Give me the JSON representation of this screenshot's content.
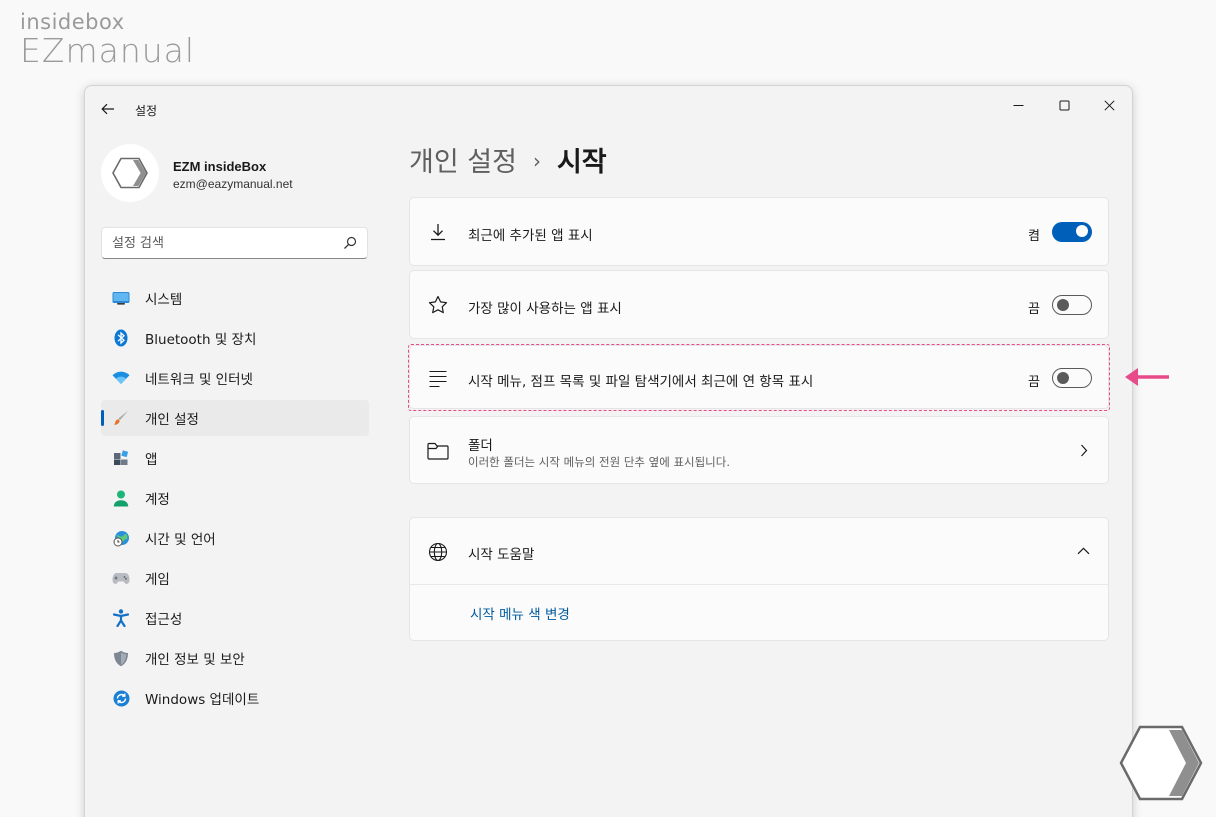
{
  "watermark": {
    "line1": "insidebox",
    "line2": "EZmanual"
  },
  "window": {
    "title": "설정"
  },
  "profile": {
    "name": "EZM insideBox",
    "email": "ezm@eazymanual.net"
  },
  "search": {
    "placeholder": "설정 검색"
  },
  "nav": {
    "items": [
      {
        "label": "시스템",
        "icon": "monitor-icon"
      },
      {
        "label": "Bluetooth 및 장치",
        "icon": "bluetooth-icon"
      },
      {
        "label": "네트워크 및 인터넷",
        "icon": "wifi-icon"
      },
      {
        "label": "개인 설정",
        "icon": "paintbrush-icon"
      },
      {
        "label": "앱",
        "icon": "apps-icon"
      },
      {
        "label": "계정",
        "icon": "person-icon"
      },
      {
        "label": "시간 및 언어",
        "icon": "globe-clock-icon"
      },
      {
        "label": "게임",
        "icon": "gamepad-icon"
      },
      {
        "label": "접근성",
        "icon": "accessibility-icon"
      },
      {
        "label": "개인 정보 및 보안",
        "icon": "shield-icon"
      },
      {
        "label": "Windows 업데이트",
        "icon": "update-icon"
      }
    ],
    "active_index": 3
  },
  "breadcrumb": {
    "parent": "개인 설정",
    "separator": "›",
    "current": "시작"
  },
  "settings": {
    "recent_apps": {
      "label": "최근에 추가된 앱 표시",
      "state": "켬",
      "on": true
    },
    "most_used": {
      "label": "가장 많이 사용하는 앱 표시",
      "state": "끔",
      "on": false
    },
    "recent_items": {
      "label": "시작 메뉴, 점프 목록 및 파일 탐색기에서 최근에 연 항목 표시",
      "state": "끔",
      "on": false
    },
    "folders": {
      "label": "폴더",
      "sub": "이러한 폴더는 시작 메뉴의 전원 단추 옆에 표시됩니다."
    }
  },
  "help": {
    "title": "시작 도움말",
    "link": "시작 메뉴 색 변경"
  },
  "colors": {
    "accent": "#005fb8",
    "highlight": "#e84b8a",
    "link": "#005a9e"
  }
}
